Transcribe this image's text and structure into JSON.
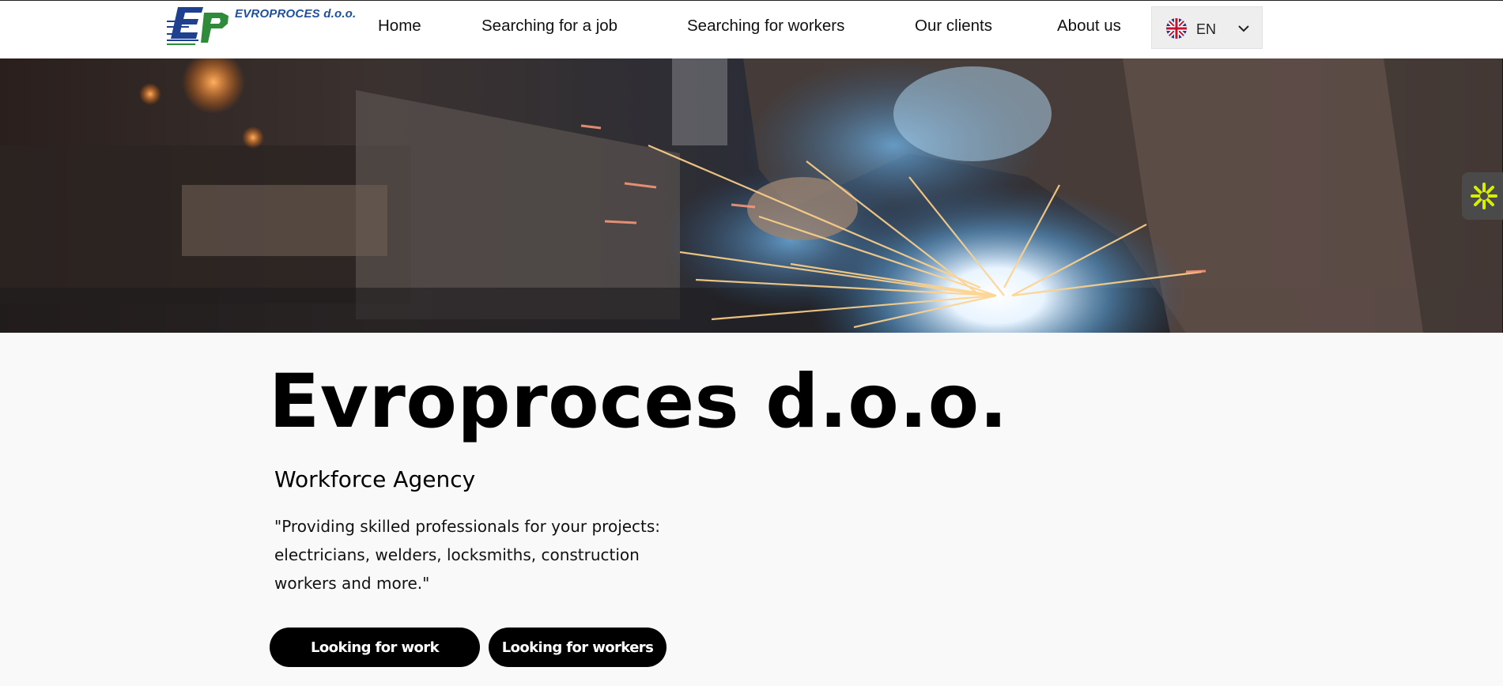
{
  "header": {
    "logo_text": "EVROPROCES d.o.o.",
    "nav": [
      "Home",
      "Searching for a job",
      "Searching for workers",
      "Our clients",
      "About us"
    ],
    "language": {
      "code": "EN",
      "flag_icon": "uk-flag-icon",
      "chevron_icon": "chevron-down-icon"
    }
  },
  "hero": {
    "image": "welder-sparks-photo"
  },
  "widget": {
    "icon": "accessibility-asterisk-icon"
  },
  "main": {
    "title": "Evroproces d.o.o.",
    "subtitle": "Workforce Agency",
    "quote": "\"Providing skilled professionals for your projects: electricians, welders, locksmiths, construction workers and more.\"",
    "buttons": {
      "work": "Looking for work",
      "workers": "Looking for workers"
    }
  },
  "colors": {
    "brand_blue": "#1f4f9e",
    "brand_green": "#2e8b3a",
    "button_bg": "#000000",
    "page_bg": "#f9f9f9",
    "widget_accent": "#d8f000"
  }
}
